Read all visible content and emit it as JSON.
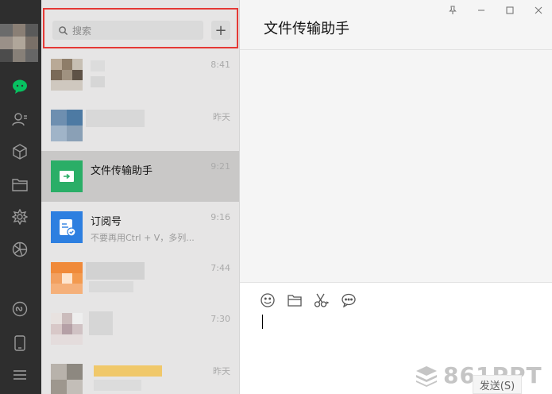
{
  "search": {
    "placeholder": "搜索",
    "add_label": "+"
  },
  "chats": [
    {
      "title": "",
      "subtitle": "",
      "time": "8:41",
      "blurred": true
    },
    {
      "title": "",
      "subtitle": "",
      "time": "昨天",
      "blurred": true
    },
    {
      "title": "文件传输助手",
      "subtitle": "",
      "time": "9:21",
      "blurred": false,
      "active": true
    },
    {
      "title": "订阅号",
      "subtitle": "不要再用Ctrl + V，多列...",
      "time": "9:16",
      "blurred": false
    },
    {
      "title": "",
      "subtitle": "",
      "time": "7:44",
      "blurred": true
    },
    {
      "title": "",
      "subtitle": "",
      "time": "7:30",
      "blurred": true
    },
    {
      "title": "",
      "subtitle": "",
      "time": "昨天",
      "blurred": true
    }
  ],
  "main": {
    "title": "文件传输助手",
    "send_label": "发送(S)"
  },
  "watermark": {
    "text": "861PPT"
  },
  "colors": {
    "rail": "#2e2e2e",
    "accent_green": "#07c160",
    "highlight": "#e53935",
    "subscription_blue": "#2d7fe0",
    "file_green": "#2aae67"
  },
  "icons": {
    "rail": [
      "chat-icon",
      "contacts-icon",
      "collections-icon",
      "files-icon",
      "moments-icon",
      "channels-icon",
      "mini-program-icon",
      "phone-icon",
      "menu-icon"
    ],
    "toolbar": [
      "emoji-icon",
      "folder-icon",
      "scissors-icon",
      "chat-bubble-icon"
    ],
    "window": [
      "pin-icon",
      "minimize-icon",
      "maximize-icon",
      "close-icon"
    ]
  }
}
